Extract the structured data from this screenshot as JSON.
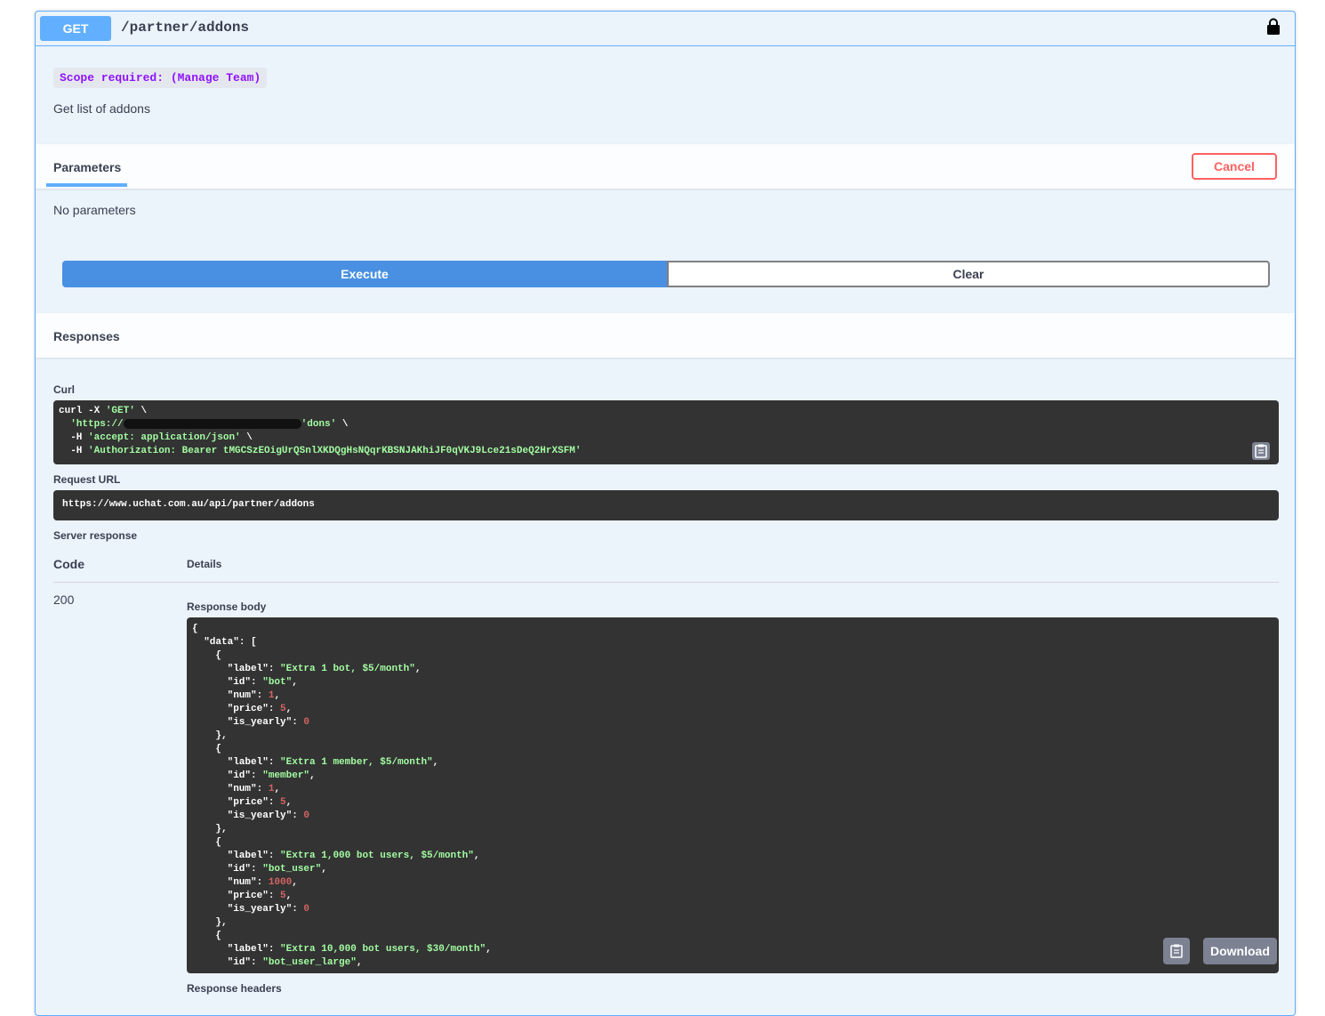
{
  "operation": {
    "method": "GET",
    "path": "/partner/addons",
    "scope_text": "Scope required: (Manage Team)",
    "description": "Get list of addons"
  },
  "parameters": {
    "tab_label": "Parameters",
    "cancel_label": "Cancel",
    "empty_text": "No parameters",
    "execute_label": "Execute",
    "clear_label": "Clear"
  },
  "responses": {
    "title": "Responses",
    "curl_label": "Curl",
    "curl": {
      "line1_cmd": "curl -X ",
      "line1_method": "'GET'",
      "line1_end": " \\",
      "line2_start": "'https://",
      "line2_mid": "'dons'",
      "line2_end": " \\",
      "line3_flag": "  -H ",
      "line3_val": "'accept: application/json'",
      "line3_end": " \\",
      "line4_flag": "  -H ",
      "line4_val": "'Authorization: Bearer tMGCSzEOigUrQSnlXKDQgHsNQqrKBSNJAKhiJF0qVKJ9Lce21sDeQ2HrXSFM'"
    },
    "request_url_label": "Request URL",
    "request_url": "https://www.uchat.com.au/api/partner/addons",
    "server_response_label": "Server response",
    "col_code": "Code",
    "col_details": "Details",
    "status_code": "200",
    "response_body_label": "Response body",
    "download_label": "Download",
    "response_headers_label": "Response headers",
    "body": {
      "root_key": "\"data\"",
      "items": [
        {
          "label": "\"Extra 1 bot, $5/month\"",
          "id": "\"bot\"",
          "num": "1",
          "price": "5",
          "is_yearly": "0"
        },
        {
          "label": "\"Extra 1 member, $5/month\"",
          "id": "\"member\"",
          "num": "1",
          "price": "5",
          "is_yearly": "0"
        },
        {
          "label": "\"Extra 1,000 bot users, $5/month\"",
          "id": "\"bot_user\"",
          "num": "1000",
          "price": "5",
          "is_yearly": "0"
        },
        {
          "label": "\"Extra 10,000 bot users, $30/month\"",
          "id": "\"bot_user_large\""
        }
      ]
    }
  },
  "icons": {
    "lock": "lock-icon",
    "copy": "clipboard-icon"
  }
}
